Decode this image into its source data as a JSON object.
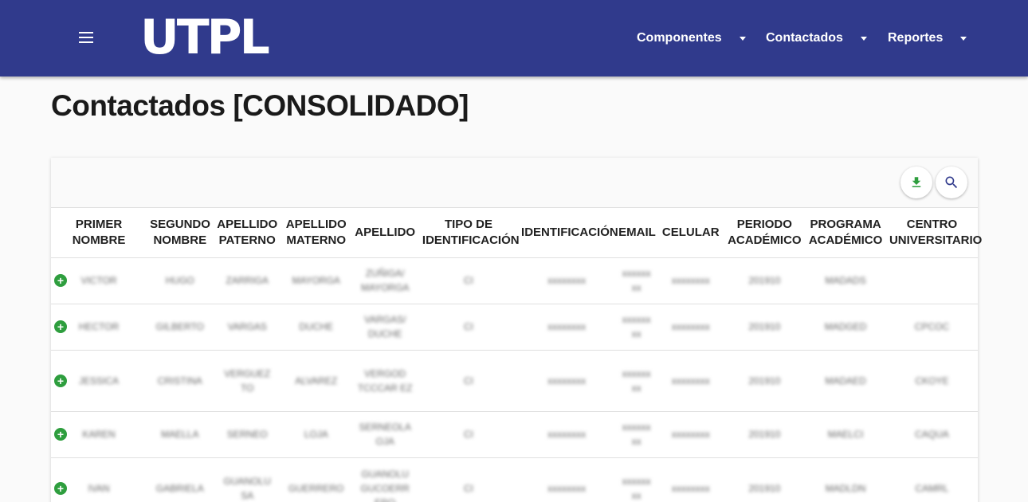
{
  "header": {
    "logo": "UTPL",
    "nav": [
      {
        "label": "Componentes"
      },
      {
        "label": "Contactados"
      },
      {
        "label": "Reportes"
      }
    ]
  },
  "page": {
    "title": "Contactados [CONSOLIDADO]"
  },
  "toolbar": {
    "download_icon": "download-icon",
    "search_icon": "search-icon"
  },
  "table": {
    "columns": [
      "PRIMER NOMBRE",
      "SEGUNDO NOMBRE",
      "APELLIDO PATERNO",
      "APELLIDO MATERNO",
      "APELLIDO",
      "TIPO DE IDENTIFICACIÓN",
      "IDENTIFICACIÓN",
      "EMAIL",
      "CELULAR",
      "PERIODO ACADÉMICO",
      "PROGRAMA ACADÉMICO",
      "CENTRO UNIVERSITARIO"
    ],
    "rows": [
      [
        "VICTOR",
        "HUGO",
        "ZARRIGA",
        "MAYORGA",
        "ZUÑIGA/ MAYORGA",
        "CI",
        "xxxxxxxx",
        "xxxxxx xx",
        "xxxxxxxx",
        "201910",
        "MADADS",
        ""
      ],
      [
        "HECTOR",
        "GILBERTO",
        "VARGAS",
        "DUCHE",
        "VARGAS/ DUCHE",
        "CI",
        "xxxxxxxx",
        "xxxxxx xx",
        "xxxxxxxx",
        "201910",
        "MADGED",
        "CPCOC"
      ],
      [
        "JESSICA",
        "CRISTINA",
        "VERGUEZ TO",
        "ALVAREZ",
        "VERGOD TCCCAR EZ",
        "CI",
        "xxxxxxxx",
        "xxxxxx xx",
        "xxxxxxxx",
        "201910",
        "MADAED",
        "CKOYE"
      ],
      [
        "KAREN",
        "MAELLA",
        "SERNEO",
        "LOJA",
        "SERNEOLA OJA",
        "CI",
        "xxxxxxxx",
        "xxxxxx xx",
        "xxxxxxxx",
        "201910",
        "MAELCI",
        "CAQUA"
      ],
      [
        "IVAN",
        "GABRIELA",
        "GUANOLU SA",
        "GUERRERO",
        "GUANOLU GUCOERR ERO",
        "CI",
        "xxxxxxxx",
        "xxxxxx xx",
        "xxxxxxxx",
        "201910",
        "MADLDN",
        "CAMRL"
      ]
    ]
  }
}
